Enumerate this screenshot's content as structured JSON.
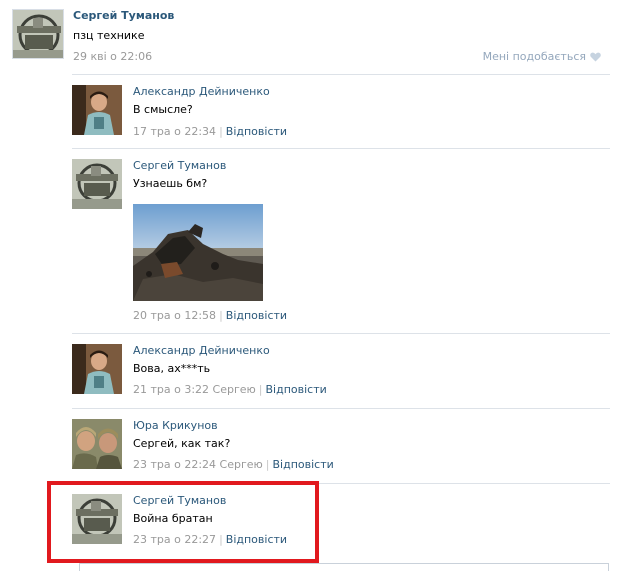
{
  "post": {
    "author": "Сергей Туманов",
    "text": "пзц технике",
    "date": "29 кві о 22:06",
    "like_label": "Мені подобається"
  },
  "replies": [
    {
      "author": "Александр Дейниченко",
      "text": "В смысле?",
      "date": "17 тра о 22:34",
      "reply_label": "Відповісти"
    },
    {
      "author": "Сергей Туманов",
      "text": "Узнаешь бм?",
      "date": "20 тра о 12:58",
      "reply_label": "Відповісти"
    },
    {
      "author": "Александр Дейниченко",
      "text": "Вова, ах***ть",
      "date": "21 тра о 3:22 Сергею",
      "reply_label": "Відповісти"
    },
    {
      "author": "Юра Крикунов",
      "text": "Сергей, как так?",
      "date": "23 тра о 22:24 Сергею",
      "reply_label": "Відповісти"
    },
    {
      "author": "Сергей Туманов",
      "text": "Война братан",
      "date": "23 тра о 22:27",
      "reply_label": "Відповісти"
    }
  ],
  "colors": {
    "link": "#2b587a",
    "meta": "#999999",
    "like": "#94a7bc",
    "divider": "#dde2e8",
    "highlight": "#e1191e"
  },
  "icons": {
    "like": "heart-icon"
  }
}
